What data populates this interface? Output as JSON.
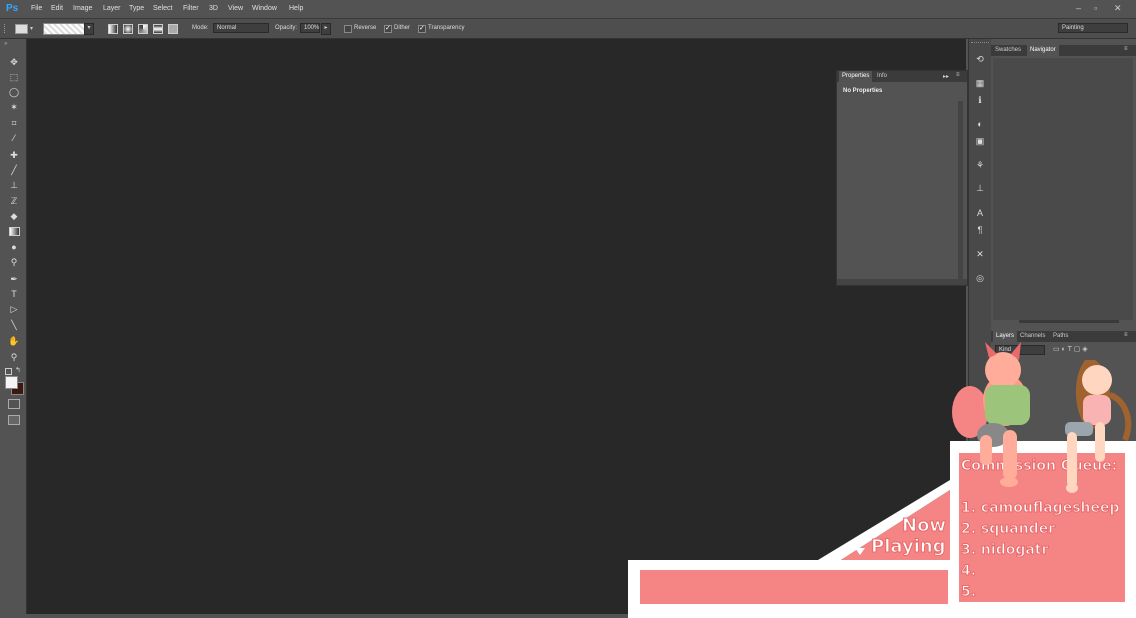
{
  "app": {
    "logo": "Ps"
  },
  "menu": [
    "File",
    "Edit",
    "Image",
    "Layer",
    "Type",
    "Select",
    "Filter",
    "3D",
    "View",
    "Window",
    "Help"
  ],
  "window_controls": {
    "minimize": "–",
    "restore": "▫",
    "close": "✕"
  },
  "options": {
    "mode_label": "Mode:",
    "mode_value": "Normal",
    "opacity_label": "Opacity:",
    "opacity_value": "100%",
    "reverse_label": "Reverse",
    "dither_label": "Dither",
    "transparency_label": "Transparency",
    "workspace_value": "Painting"
  },
  "properties_panel": {
    "tabs": [
      "Properties",
      "Info"
    ],
    "content": "No Properties"
  },
  "right_panel": {
    "top_tabs": [
      "Swatches",
      "Navigator"
    ],
    "layers_tabs": [
      "Layers",
      "Channels",
      "Paths"
    ],
    "kind_label": "Kind"
  },
  "overlay": {
    "queue_title": "Commission Queue:",
    "queue_items": [
      "1. camouflagesheep",
      "2. squander",
      "3. nidogatr",
      "4.",
      "5."
    ],
    "now_playing": [
      "Now",
      "Playing"
    ],
    "now_playing_value": ""
  },
  "colors": {
    "accent": "#31a8ff",
    "overlay_pink": "#f58485",
    "canvas": "#282828"
  }
}
